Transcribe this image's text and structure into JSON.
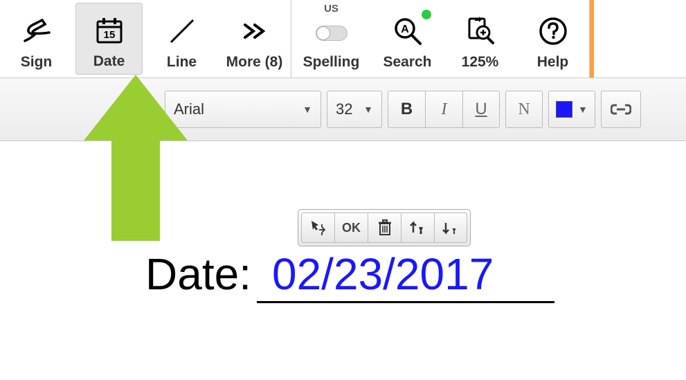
{
  "toolbar": {
    "sign": "Sign",
    "date": "Date",
    "line": "Line",
    "more": "More (8)",
    "spelling": "Spelling",
    "spelling_badge": "US",
    "search": "Search",
    "zoom": "125%",
    "help": "Help"
  },
  "format": {
    "font": "Arial",
    "size": "32",
    "bold": "B",
    "italic": "I",
    "underline": "U",
    "normal": "N",
    "color_hex": "#1a17ff"
  },
  "edit_toolbar": {
    "ok": "OK"
  },
  "document": {
    "label": "Date:",
    "value": "02/23/2017"
  }
}
